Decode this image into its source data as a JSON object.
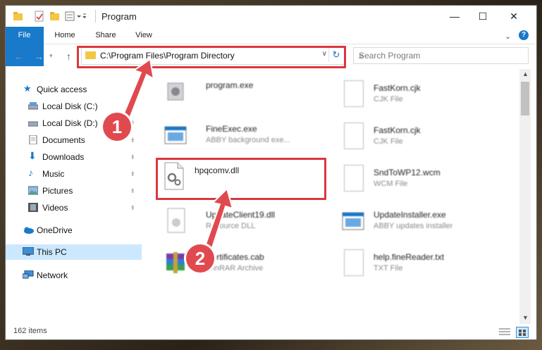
{
  "window": {
    "title": "Program"
  },
  "ribbon": {
    "tabs": [
      "File",
      "Home",
      "Share",
      "View"
    ]
  },
  "address": {
    "path": "C:\\Program Files\\Program Directory"
  },
  "search": {
    "placeholder": "Search Program"
  },
  "nav": {
    "items": [
      {
        "label": "Quick access",
        "icon": "star-icon"
      },
      {
        "label": "Local Disk (C:)",
        "icon": "drive-icon"
      },
      {
        "label": "Local Disk (D:)",
        "icon": "drive-icon"
      },
      {
        "label": "Documents",
        "icon": "documents-icon"
      },
      {
        "label": "Downloads",
        "icon": "downloads-icon"
      },
      {
        "label": "Music",
        "icon": "music-icon"
      },
      {
        "label": "Pictures",
        "icon": "pictures-icon"
      },
      {
        "label": "Videos",
        "icon": "videos-icon"
      },
      {
        "label": "OneDrive",
        "icon": "cloud-icon"
      },
      {
        "label": "This PC",
        "icon": "computer-icon"
      },
      {
        "label": "Network",
        "icon": "network-icon"
      }
    ]
  },
  "files": {
    "left": [
      {
        "name": "program.exe",
        "type": ""
      },
      {
        "name": "FineExec.exe",
        "type": "ABBY background exe..."
      },
      {
        "name": "hpqcomv.dll",
        "type": ""
      },
      {
        "name": "UpdateClient19.dll",
        "type": "Resource DLL"
      },
      {
        "name": "Certificates.cab",
        "type": "WinRAR Archive"
      }
    ],
    "right": [
      {
        "name": "FastKorn.cjk",
        "type": "CJK File"
      },
      {
        "name": "FastKorn.cjk",
        "type": "CJK File"
      },
      {
        "name": "SndToWP12.wcm",
        "type": "WCM File"
      },
      {
        "name": "UpdateInstaller.exe",
        "type": "ABBY updates installer"
      },
      {
        "name": "help.fineReader.txt",
        "type": "TXT File"
      }
    ]
  },
  "status": {
    "items": "162 items"
  },
  "badges": {
    "one": "1",
    "two": "2"
  },
  "colors": {
    "accent": "#1979ca",
    "highlight": "#d9383f",
    "selected": "#cce8ff"
  }
}
